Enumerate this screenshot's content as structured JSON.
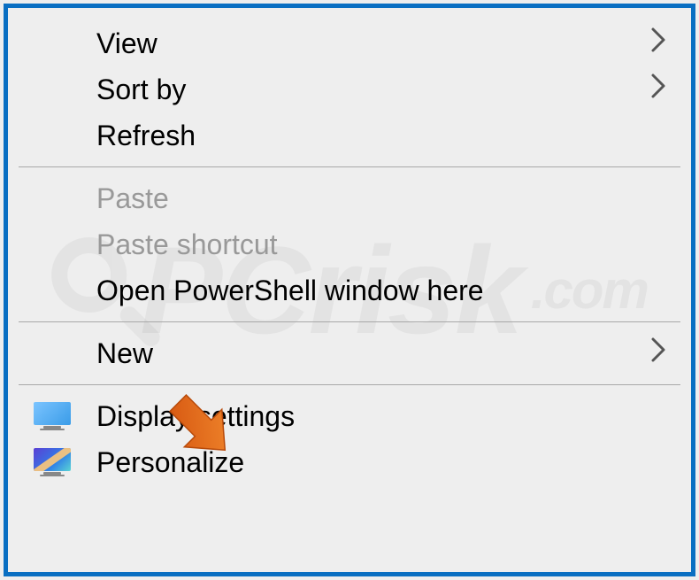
{
  "menu": {
    "items": [
      {
        "id": "view",
        "label": "View",
        "enabled": true,
        "submenu": true,
        "icon": null
      },
      {
        "id": "sort-by",
        "label": "Sort by",
        "enabled": true,
        "submenu": true,
        "icon": null
      },
      {
        "id": "refresh",
        "label": "Refresh",
        "enabled": true,
        "submenu": false,
        "icon": null
      }
    ],
    "group2": [
      {
        "id": "paste",
        "label": "Paste",
        "enabled": false,
        "submenu": false,
        "icon": null
      },
      {
        "id": "paste-shortcut",
        "label": "Paste shortcut",
        "enabled": false,
        "submenu": false,
        "icon": null
      },
      {
        "id": "open-powershell",
        "label": "Open PowerShell window here",
        "enabled": true,
        "submenu": false,
        "icon": null
      }
    ],
    "group3": [
      {
        "id": "new",
        "label": "New",
        "enabled": true,
        "submenu": true,
        "icon": null
      }
    ],
    "group4": [
      {
        "id": "display-settings",
        "label": "Display settings",
        "enabled": true,
        "submenu": false,
        "icon": "monitor"
      },
      {
        "id": "personalize",
        "label": "Personalize",
        "enabled": true,
        "submenu": false,
        "icon": "monitor-personalize"
      }
    ]
  },
  "watermark": {
    "main": "PCrisk",
    "sub": ".com"
  },
  "annotation": {
    "target": "display-settings",
    "color": "#e8671a"
  }
}
